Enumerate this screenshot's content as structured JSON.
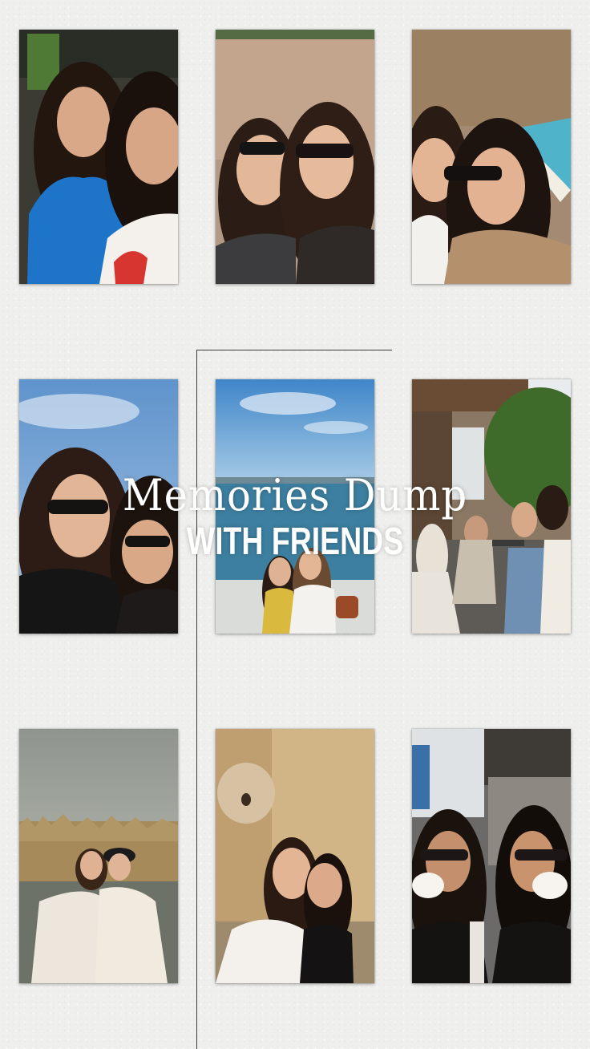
{
  "title": {
    "main": "Memories Dump",
    "sub": "WITH FRIENDS"
  },
  "photos": [
    {
      "id": "p1",
      "subject": "two-friends-cafe-selfie"
    },
    {
      "id": "p2",
      "subject": "two-friends-sunglasses-stone-wall"
    },
    {
      "id": "p3",
      "subject": "two-friends-coastal-cliff-beach"
    },
    {
      "id": "p4",
      "subject": "two-friends-sunglasses-blue-sky"
    },
    {
      "id": "p5",
      "subject": "friends-seaside-bosphorus-view"
    },
    {
      "id": "p6",
      "subject": "group-outdoor-cafe-terrace"
    },
    {
      "id": "p7",
      "subject": "two-friends-lakeside-reeds"
    },
    {
      "id": "p8",
      "subject": "two-friends-fountain-stone-wall"
    },
    {
      "id": "p9",
      "subject": "two-friends-coffee-cups"
    }
  ]
}
